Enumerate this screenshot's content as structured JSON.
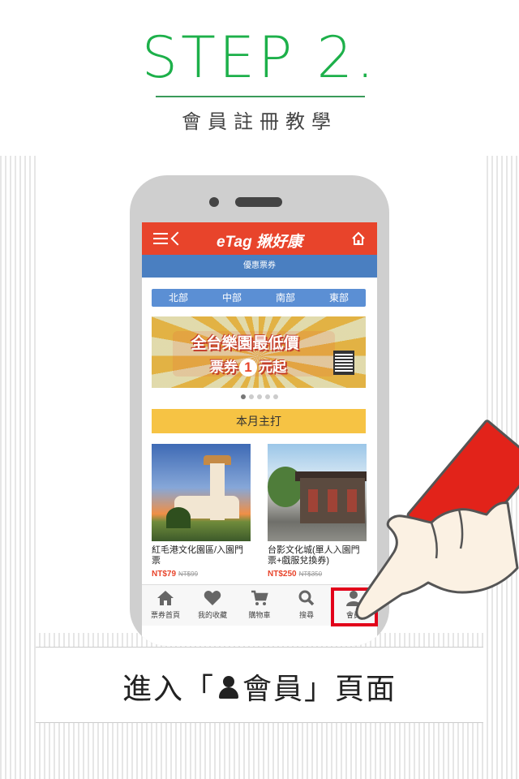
{
  "step": {
    "title": "STEP 2.",
    "subtitle": "會員註冊教學"
  },
  "app": {
    "logo": "eTag 揪好康",
    "section_title": "優惠票券",
    "regions": [
      "北部",
      "中部",
      "南部",
      "東部"
    ],
    "banner": {
      "line1": "全台樂園最低價",
      "line2_pre": "票券",
      "line2_num": "1",
      "line2_post": "元起"
    },
    "monthly_label": "本月主打",
    "products": [
      {
        "name": "紅毛港文化園區/入園門票",
        "price": "NT$79",
        "old_price": "NT$99"
      },
      {
        "name": "台影文化城(單人入園門票+戲服兌換券)",
        "price": "NT$250",
        "old_price": "NT$350"
      }
    ],
    "tabs": [
      {
        "label": "票券首頁",
        "icon": "home-icon"
      },
      {
        "label": "我的收藏",
        "icon": "heart-icon"
      },
      {
        "label": "購物車",
        "icon": "cart-icon"
      },
      {
        "label": "搜尋",
        "icon": "search-icon"
      },
      {
        "label": "會員",
        "icon": "user-icon"
      }
    ]
  },
  "caption": {
    "pre": "進入「",
    "word": "會員",
    "post": "」頁面"
  },
  "colors": {
    "accent_green": "#1db04a",
    "topbar_red": "#e8442b",
    "subbar_blue": "#4a7fc1",
    "highlight": "#e2001a",
    "monthly_yellow": "#f6c344"
  }
}
